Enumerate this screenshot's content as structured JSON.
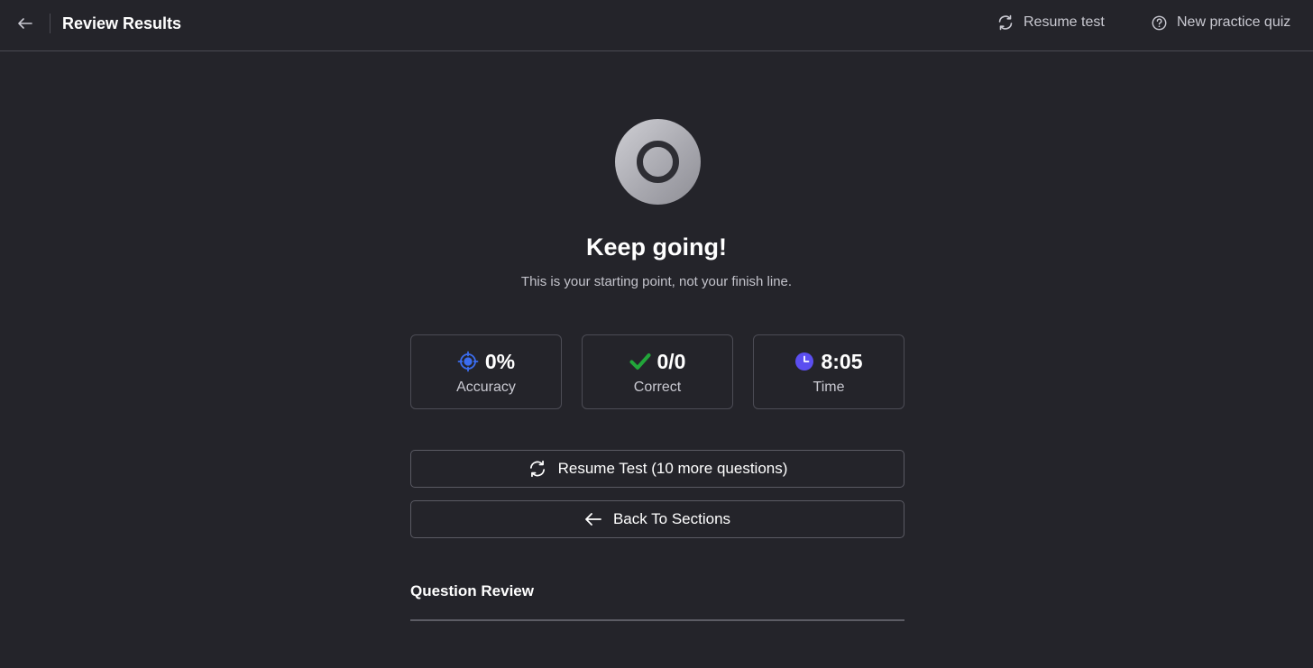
{
  "header": {
    "title": "Review Results",
    "actions": [
      {
        "label": "Resume test",
        "icon": "refresh-icon"
      },
      {
        "label": "New practice quiz",
        "icon": "help-circle-icon"
      }
    ]
  },
  "hero": {
    "icon": "target-ring-icon",
    "headline": "Keep going!",
    "subline": "This is your starting point, not your finish line."
  },
  "stats": [
    {
      "value": "0%",
      "label": "Accuracy",
      "icon": "crosshair-icon",
      "color": "#3b6df0"
    },
    {
      "value": "0/0",
      "label": "Correct",
      "icon": "checkmark-icon",
      "color": "#22a63a"
    },
    {
      "value": "8:05",
      "label": "Time",
      "icon": "clock-icon",
      "color": "#5b4ef0"
    }
  ],
  "buttons": {
    "resume": {
      "label": "Resume Test (10 more questions)",
      "icon": "refresh-icon"
    },
    "back": {
      "label": "Back To Sections",
      "icon": "arrow-left-icon"
    }
  },
  "review": {
    "heading": "Question Review"
  }
}
